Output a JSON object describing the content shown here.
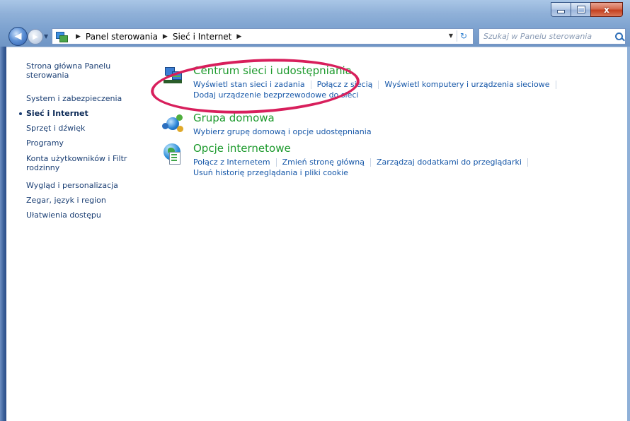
{
  "window": {
    "buttons": {
      "minimize": "",
      "maximize": "",
      "close": "x"
    }
  },
  "nav": {
    "breadcrumb": [
      "Panel sterowania",
      "Sieć i Internet"
    ],
    "search_placeholder": "Szukaj w Panelu sterowania"
  },
  "sidebar": {
    "items": [
      {
        "label": "Strona główna Panelu sterowania",
        "active": false
      },
      {
        "label": "System i zabezpieczenia",
        "active": false
      },
      {
        "label": "Sieć i Internet",
        "active": true
      },
      {
        "label": "Sprzęt i dźwięk",
        "active": false
      },
      {
        "label": "Programy",
        "active": false
      },
      {
        "label": "Konta użytkowników i Filtr rodzinny",
        "active": false
      },
      {
        "label": "Wygląd i personalizacja",
        "active": false
      },
      {
        "label": "Zegar, język i region",
        "active": false
      },
      {
        "label": "Ułatwienia dostępu",
        "active": false
      }
    ]
  },
  "categories": [
    {
      "title": "Centrum sieci i udostępniania",
      "icon": "network-center-icon",
      "links_row1": [
        "Wyświetl stan sieci i zadania",
        "Połącz z siecią",
        "Wyświetl komputery i urządzenia sieciowe"
      ],
      "links_row2": [
        "Dodaj urządzenie bezprzewodowe do sieci"
      ]
    },
    {
      "title": "Grupa domowa",
      "icon": "homegroup-icon",
      "links_row1": [
        "Wybierz grupę domową i opcje udostępniania"
      ],
      "links_row2": []
    },
    {
      "title": "Opcje internetowe",
      "icon": "internet-options-icon",
      "links_row1": [
        "Połącz z Internetem",
        "Zmień stronę główną",
        "Zarządzaj dodatkami do przeglądarki"
      ],
      "links_row2": [
        "Usuń historię przeglądania i pliki cookie"
      ]
    }
  ],
  "colors": {
    "category_title": "#1d9a2d",
    "link": "#1657a8",
    "annotation": "#d81f5c"
  }
}
